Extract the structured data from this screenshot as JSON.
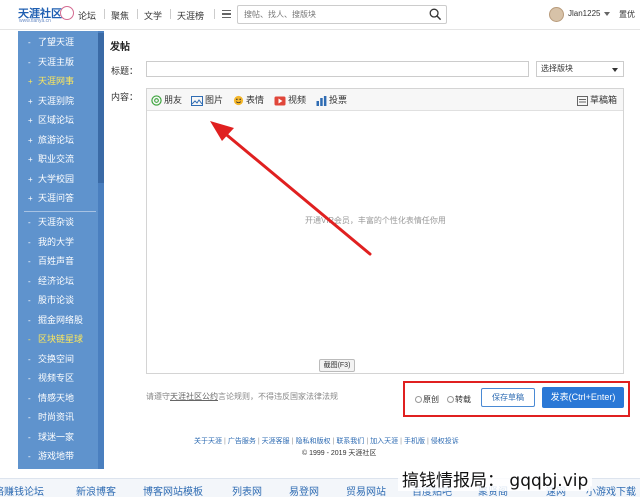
{
  "header": {
    "logo_text": "天涯社区",
    "logo_url": "www.tianya.cn",
    "nav": [
      "论坛",
      "聚焦",
      "文学",
      "天涯榜"
    ],
    "search_placeholder": "搜帖、找人、搜版块",
    "username": "Jlan1225",
    "right_label": "置优"
  },
  "sidebar": {
    "group1": [
      {
        "label": "了望天涯",
        "plus": false
      },
      {
        "label": "天涯主版",
        "plus": false
      },
      {
        "label": "天涯网事",
        "plus": true,
        "active": true
      },
      {
        "label": "天涯别院",
        "plus": true
      },
      {
        "label": "区域论坛",
        "plus": true
      },
      {
        "label": "旅游论坛",
        "plus": true
      },
      {
        "label": "职业交流",
        "plus": true
      },
      {
        "label": "大学校园",
        "plus": true
      },
      {
        "label": "天涯问答",
        "plus": true
      }
    ],
    "group2": [
      {
        "label": "天涯杂谈"
      },
      {
        "label": "我的大学"
      },
      {
        "label": "百姓声音"
      },
      {
        "label": "经济论坛"
      },
      {
        "label": "股市论谈"
      },
      {
        "label": "掘金网络股"
      },
      {
        "label": "区块链星球",
        "active": true
      },
      {
        "label": "交换空间"
      },
      {
        "label": "视频专区"
      },
      {
        "label": "情感天地"
      },
      {
        "label": "时尚资讯"
      },
      {
        "label": "球迷一家"
      },
      {
        "label": "游戏地带"
      }
    ]
  },
  "main": {
    "page_title": "发帖",
    "title_label": "标题：",
    "content_label": "内容：",
    "select_value": "选择版块",
    "toolbar": {
      "friend": "朋友",
      "image": "图片",
      "emoji": "表情",
      "video": "视频",
      "vote": "投票",
      "drafts": "草稿箱"
    },
    "editor_placeholder": "开通VIP会员，丰富的个性化表情任你用",
    "screenshot_btn": "截图(F3)",
    "rules_prefix": "请遵守",
    "rules_link": "天涯社区公约",
    "rules_suffix": "言论规则，不得违反国家法律法规",
    "radio_original": "原创",
    "radio_repost": "转载",
    "save_draft": "保存草稿",
    "post_btn": "发表(Ctrl+Enter)"
  },
  "footer": {
    "links": [
      "关于天涯",
      "广告服务",
      "天涯客服",
      "隐私和版权",
      "联系我们",
      "加入天涯",
      "手机版",
      "侵权投诉"
    ],
    "copyright": "© 1999 - 2019 天涯社区"
  },
  "bottom_strip": [
    "络赚钱论坛",
    "新浪博客",
    "博客网站模板",
    "列表网",
    "易登网",
    "贸易网站",
    "百度贴吧",
    "聚贤阁",
    "速网",
    "小游戏下载"
  ],
  "watermark": "搞钱情报局： gqqbj.vip",
  "colors": {
    "sidebar": "#5f93cd",
    "active_text": "#ffe85a",
    "accent": "#2a78d6",
    "annotation": "#e02020"
  }
}
